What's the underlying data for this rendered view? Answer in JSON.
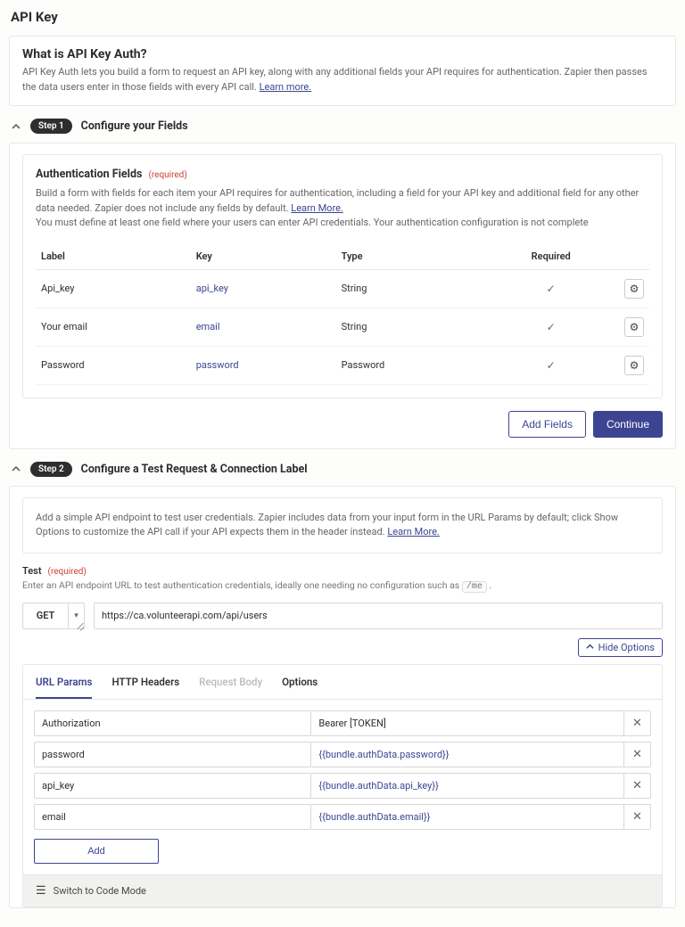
{
  "page_title": "API Key",
  "intro": {
    "heading": "What is API Key Auth?",
    "body": "API Key Auth lets you build a form to request an API key, along with any additional fields your API requires for authentication. Zapier then passes the data users enter in those fields with every API call.",
    "learn_more": "Learn more."
  },
  "step1": {
    "pill": "Step 1",
    "title": "Configure your Fields",
    "auth_heading": "Authentication Fields",
    "auth_required": "(required)",
    "auth_help1": "Build a form with fields for each item your API requires for authentication, including a field for your API key and additional field for any other data needed. Zapier does not include any fields by default.",
    "auth_learn_more": "Learn More.",
    "auth_help2": "You must define at least one field where your users can enter API credentials. Your authentication configuration is not complete",
    "columns": {
      "label": "Label",
      "key": "Key",
      "type": "Type",
      "required": "Required"
    },
    "rows": [
      {
        "label": "Api_key",
        "key": "api_key",
        "type": "String",
        "required": true
      },
      {
        "label": "Your email",
        "key": "email",
        "type": "String",
        "required": true
      },
      {
        "label": "Password",
        "key": "password",
        "type": "Password",
        "required": true
      }
    ],
    "add_fields": "Add Fields",
    "continue": "Continue"
  },
  "step2": {
    "pill": "Step 2",
    "title": "Configure a Test Request & Connection Label",
    "help": "Add a simple API endpoint to test user credentials. Zapier includes data from your input form in the URL Params by default; click Show Options to customize the API call if your API expects them in the header instead.",
    "learn_more": "Learn More.",
    "test_label": "Test",
    "test_required": "(required)",
    "test_help_pre": "Enter an API endpoint URL to test authentication credentials, ideally one needing no configuration such as",
    "test_help_code": "/me",
    "test_help_post": ".",
    "method": "GET",
    "url": "https://ca.volunteerapi.com/api/users",
    "hide_options": "Hide Options",
    "tabs": {
      "url_params": "URL Params",
      "http_headers": "HTTP Headers",
      "request_body": "Request Body",
      "options": "Options"
    },
    "params": [
      {
        "key": "Authorization",
        "value": "Bearer [TOKEN]",
        "token": false
      },
      {
        "key": "password",
        "value": "{{bundle.authData.password}}",
        "token": true
      },
      {
        "key": "api_key",
        "value": "{{bundle.authData.api_key}}",
        "token": true
      },
      {
        "key": "email",
        "value": "{{bundle.authData.email}}",
        "token": true
      }
    ],
    "add": "Add",
    "code_mode": "Switch to Code Mode"
  }
}
